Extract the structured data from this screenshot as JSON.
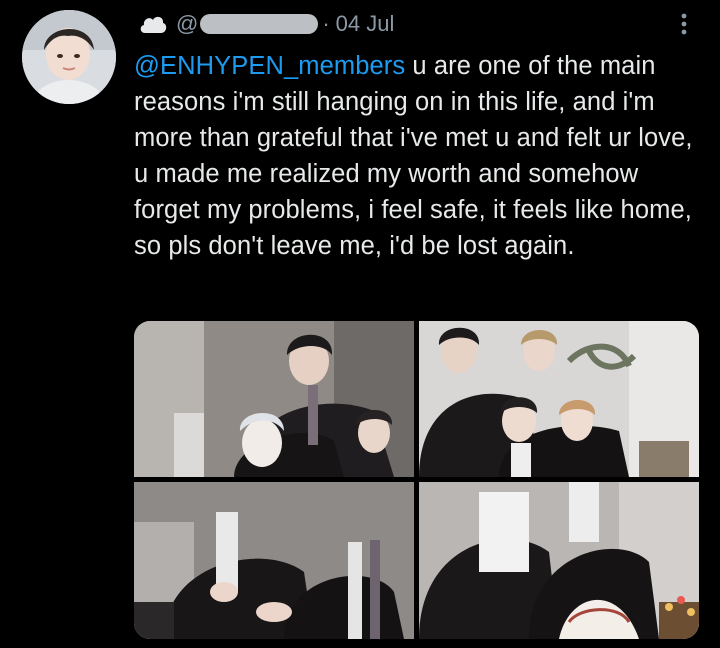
{
  "tweet": {
    "handle_prefix": "@",
    "separator": "·",
    "date": "04 Jul",
    "mention": "@ENHYPEN_members",
    "text": " u are one of the main reasons i'm still hanging on in this life, and i'm more than grateful that i've met u and felt ur love, u made me realized my worth and somehow forget my problems, i feel safe, it feels like home, so pls don't leave me, i'd be lost again."
  },
  "icons": {
    "header_badge": "cloud-icon",
    "menu": "more-vertical-icon"
  },
  "media": {
    "count": 4
  },
  "colors": {
    "background": "#000000",
    "text": "#e7e9ea",
    "muted": "#8b98a5",
    "link": "#1d9bf0"
  }
}
